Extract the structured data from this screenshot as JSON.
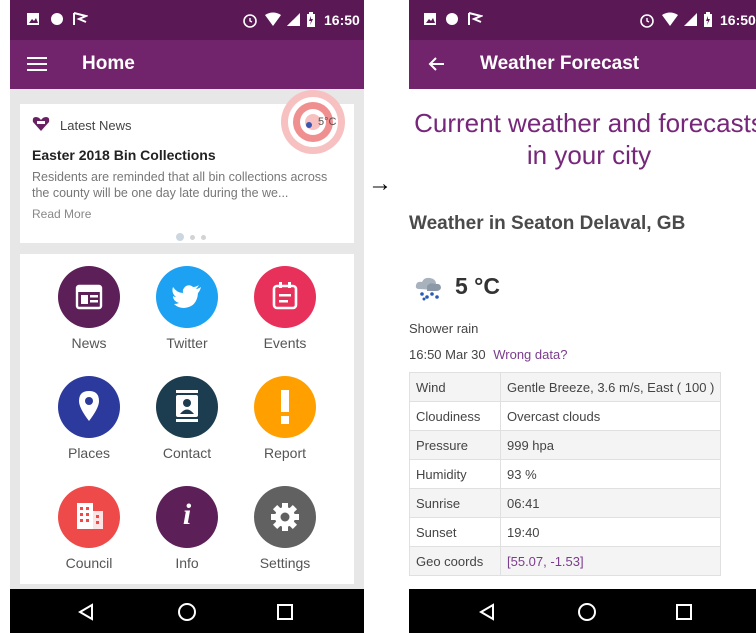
{
  "left_screen": {
    "status_bar": {
      "time": "16:50"
    },
    "header": {
      "title": "Home"
    },
    "news": {
      "section_label": "Latest News",
      "weather_badge": "5°C",
      "headline": "Easter 2018 Bin Collections",
      "body": "Residents are reminded that all bin collections across the county will be one day late during the we...",
      "read_more": "Read More",
      "pagination": {
        "count": 3,
        "active": 1
      }
    },
    "tiles": [
      {
        "label": "News",
        "color": "#5c1f57",
        "icon": "news-icon"
      },
      {
        "label": "Twitter",
        "color": "#1da1f2",
        "icon": "twitter-icon"
      },
      {
        "label": "Events",
        "color": "#e8315a",
        "icon": "events-icon"
      },
      {
        "label": "Places",
        "color": "#2b3a9c",
        "icon": "places-icon"
      },
      {
        "label": "Contact",
        "color": "#1c3d4f",
        "icon": "contact-icon"
      },
      {
        "label": "Report",
        "color": "#ffa000",
        "icon": "report-icon"
      },
      {
        "label": "Council",
        "color": "#ee4a4a",
        "icon": "council-icon"
      },
      {
        "label": "Info",
        "color": "#5c1f57",
        "icon": "info-icon"
      },
      {
        "label": "Settings",
        "color": "#616161",
        "icon": "settings-icon"
      }
    ]
  },
  "arrow": "→",
  "right_screen": {
    "status_bar": {
      "time": "16:50"
    },
    "header": {
      "title": "Weather Forecast"
    },
    "heading": "Current weather and forecasts in your city",
    "location": "Weather in Seaton Delaval, GB",
    "temperature": "5 °C",
    "condition": "Shower rain",
    "timestamp": "16:50 Mar 30",
    "wrong_data_link": "Wrong data?",
    "rows": [
      {
        "key": "Wind",
        "value": "Gentle Breeze, 3.6 m/s, East ( 100 )"
      },
      {
        "key": "Cloudiness",
        "value": "Overcast clouds"
      },
      {
        "key": "Pressure",
        "value": "999 hpa"
      },
      {
        "key": "Humidity",
        "value": "93 %"
      },
      {
        "key": "Sunrise",
        "value": "06:41"
      },
      {
        "key": "Sunset",
        "value": "19:40"
      },
      {
        "key": "Geo coords",
        "value": "[55.07, -1.53]"
      }
    ]
  },
  "colors": {
    "status_bar": "#5a1855",
    "app_bar": "#71236b",
    "heading": "#77277a",
    "link": "#7b3c8c",
    "target_ring": "#ef8f8f"
  }
}
